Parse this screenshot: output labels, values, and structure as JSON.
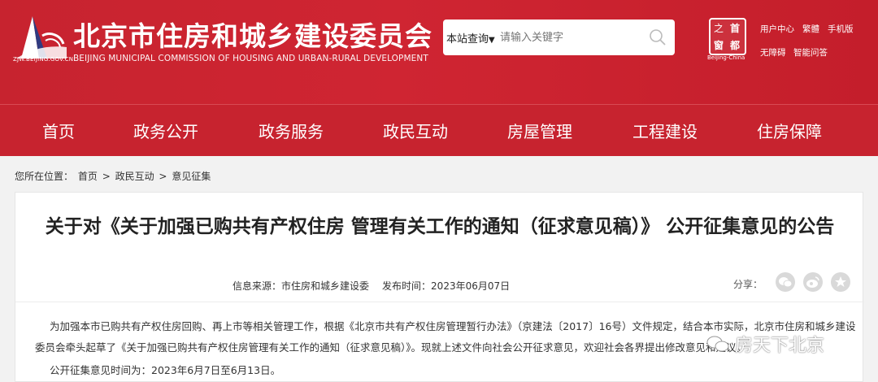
{
  "header": {
    "site_url": "ZJW.BEIJING.GOV.CN",
    "title_cn": "北京市住房和城乡建设委员会",
    "title_en": "BEIJING MUNICIPAL COMMISSION OF HOUSING AND URBAN-RURAL DEVELOPMENT",
    "search": {
      "scope_label": "本站查询",
      "placeholder": "请输入关键字"
    },
    "stamp": {
      "chars": [
        "首",
        "都",
        "之",
        "窗"
      ],
      "sub": "Beijing-China"
    },
    "top_links": [
      "用户中心",
      "繁體",
      "手机版",
      "无障碍",
      "智能问答"
    ]
  },
  "nav": {
    "items": [
      "首页",
      "政务公开",
      "政务服务",
      "政民互动",
      "房屋管理",
      "工程建设",
      "住房保障"
    ]
  },
  "breadcrumb": {
    "prefix": "您所在位置：",
    "items": [
      "首页",
      "政民互动",
      "意见征集"
    ],
    "sep": ">"
  },
  "article": {
    "title": "关于对《关于加强已购共有产权住房 管理有关工作的通知（征求意见稿）》 公开征集意见的公告",
    "source_label": "信息来源：",
    "source": "市住房和城乡建设委",
    "date_label": "发布时间：",
    "date": "2023年06月07日",
    "share_label": "分享：",
    "paragraph_1": "为加强本市已购共有产权住房回购、再上市等相关管理工作，根据《北京市共有产权住房管理暂行办法》（京建法〔2017〕16号）文件规定，结合本市实际，北京市住房和城乡建设委员会牵头起草了《关于加强已购共有产权住房管理有关工作的通知（征求意见稿）》。现就上述文件向社会公开征求意见，欢迎社会各界提出修改意见和建议。",
    "paragraph_2": "公开征集意见时间为：2023年6月7日至6月13日。"
  },
  "watermark": {
    "text": "房天下北京"
  },
  "colors": {
    "brand_red": "#c7232f",
    "text_dark": "#222222"
  }
}
